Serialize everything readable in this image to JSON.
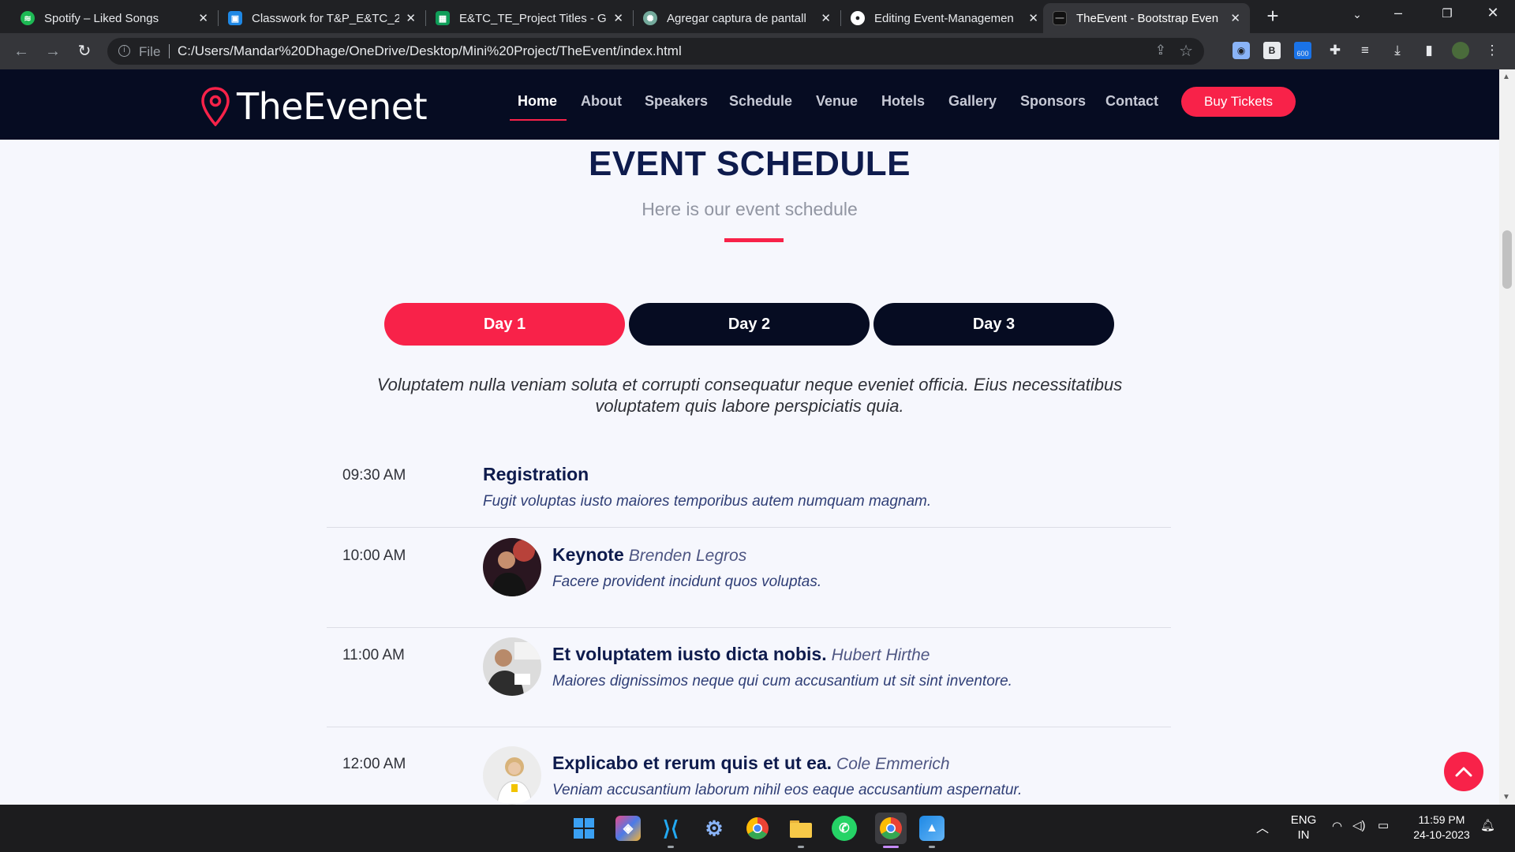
{
  "browser": {
    "tabs": [
      {
        "title": "Spotify – Liked Songs",
        "icon": "spotify-icon",
        "color": "#1db954",
        "active": false
      },
      {
        "title": "Classwork for T&P_E&TC_2",
        "icon": "classroom-icon",
        "color": "#1e88e5",
        "active": false
      },
      {
        "title": "E&TC_TE_Project Titles - Go",
        "icon": "sheets-icon",
        "color": "#0f9d58",
        "active": false
      },
      {
        "title": "Agregar captura de pantall",
        "icon": "chatgpt-icon",
        "color": "#74aa9c",
        "active": false
      },
      {
        "title": "Editing Event-Managemen",
        "icon": "github-icon",
        "color": "#ffffff",
        "active": false
      },
      {
        "title": "TheEvent - Bootstrap Even",
        "icon": "site-icon",
        "color": "#111111",
        "active": true
      }
    ],
    "scheme_label": "File",
    "url": "C:/Users/Mandar%20Dhage/OneDrive/Desktop/Mini%20Project/TheEvent/index.html",
    "ext_badge": "600"
  },
  "site": {
    "logo": "TheEvenet",
    "nav": [
      "Home",
      "About",
      "Speakers",
      "Schedule",
      "Venue",
      "Hotels",
      "Gallery",
      "Sponsors",
      "Contact"
    ],
    "buy_tickets": "Buy Tickets",
    "accent": "#f82249",
    "navy": "#060c22"
  },
  "schedule": {
    "title": "EVENT SCHEDULE",
    "subtitle": "Here is our event schedule",
    "days": [
      "Day 1",
      "Day 2",
      "Day 3"
    ],
    "intro": "Voluptatem nulla veniam soluta et corrupti consequatur neque eveniet officia. Eius necessitatibus voluptatem quis labore perspiciatis quia.",
    "items": [
      {
        "time": "09:30 AM",
        "title": "Registration",
        "speaker": "",
        "desc": "Fugit voluptas iusto maiores temporibus autem numquam magnam."
      },
      {
        "time": "10:00 AM",
        "title": "Keynote",
        "speaker": "Brenden Legros",
        "desc": "Facere provident incidunt quos voluptas."
      },
      {
        "time": "11:00 AM",
        "title": "Et voluptatem iusto dicta nobis.",
        "speaker": "Hubert Hirthe",
        "desc": "Maiores dignissimos neque qui cum accusantium ut sit sint inventore."
      },
      {
        "time": "12:00 AM",
        "title": "Explicabo et rerum quis et ut ea.",
        "speaker": "Cole Emmerich",
        "desc": "Veniam accusantium laborum nihil eos eaque accusantium aspernatur."
      }
    ]
  },
  "taskbar": {
    "lang": "ENG",
    "region": "IN",
    "time": "11:59 PM",
    "date": "24-10-2023"
  }
}
